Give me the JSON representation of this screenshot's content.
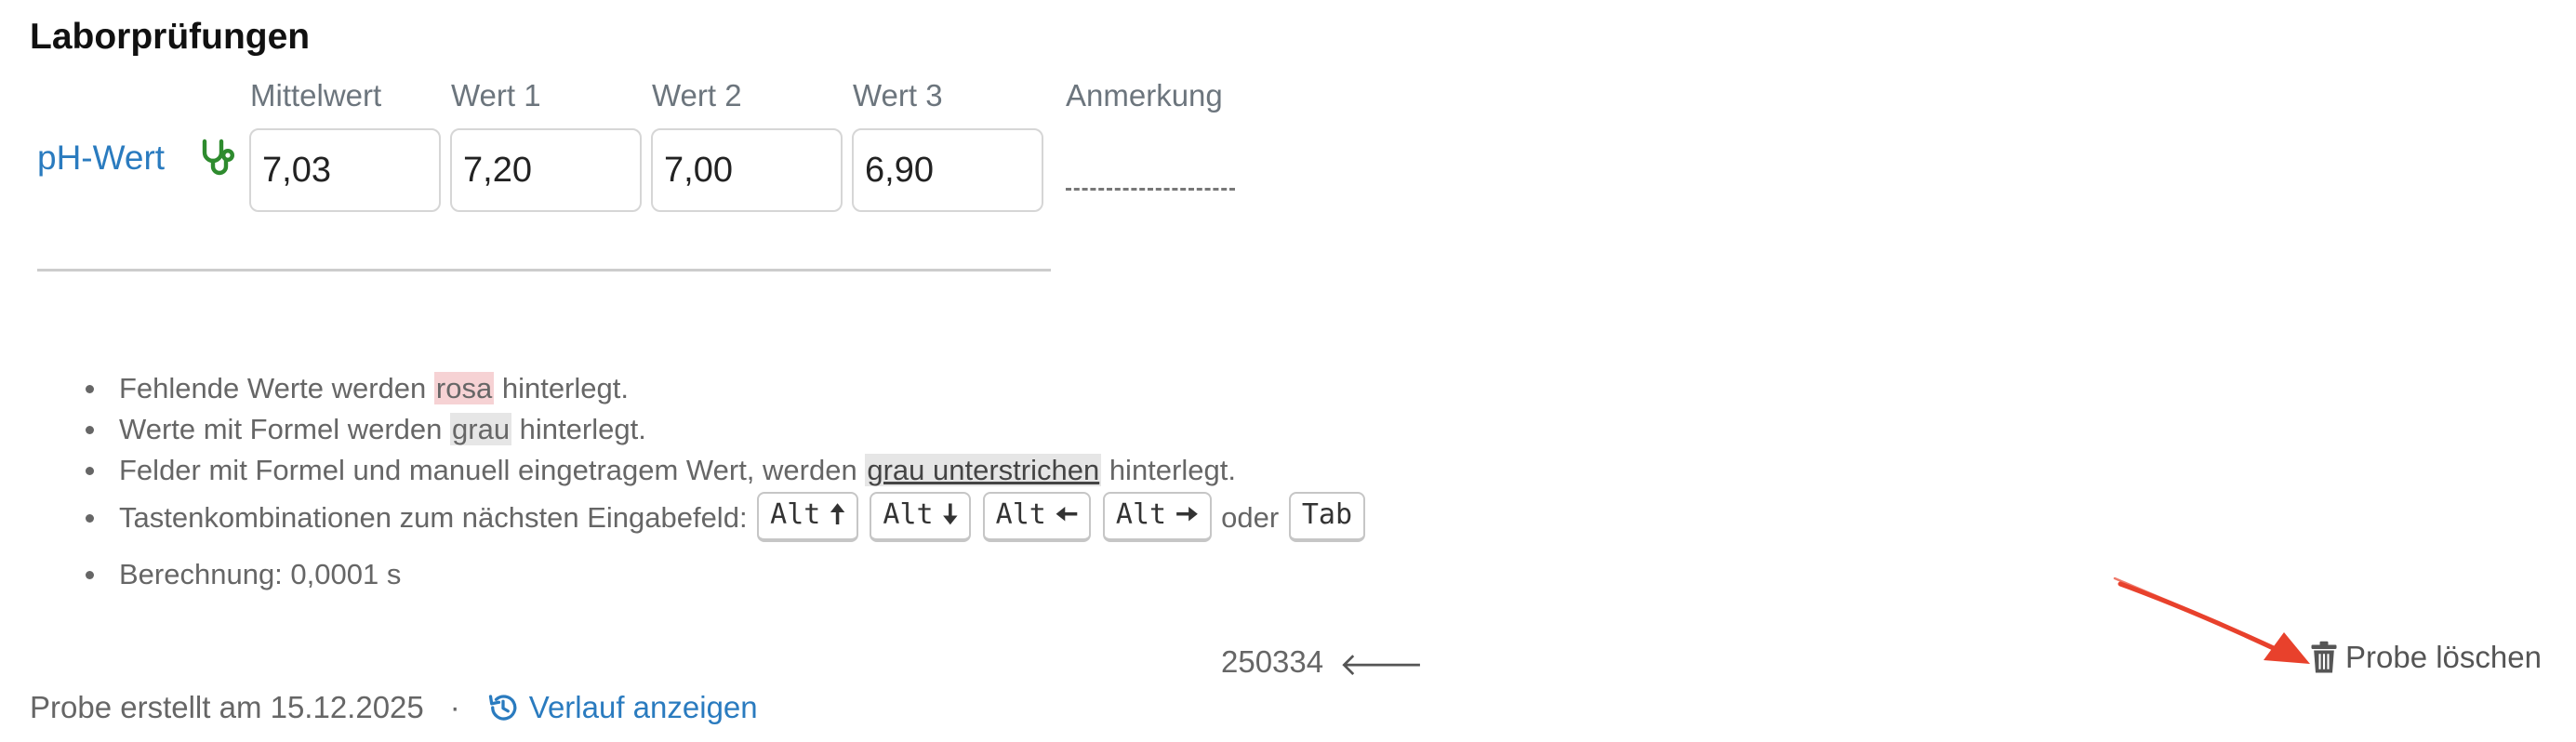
{
  "section": {
    "title": "Laborprüfungen"
  },
  "columns": [
    "Mittelwert",
    "Wert 1",
    "Wert 2",
    "Wert 3",
    "Anmerkung"
  ],
  "parameter": {
    "name": "pH-Wert",
    "icon": "stethoscope-icon",
    "values": {
      "mittelwert": "7,03",
      "wert1": "7,20",
      "wert2": "7,00",
      "wert3": "6,90"
    },
    "remark": ""
  },
  "legend": {
    "missing": {
      "prefix": "Fehlende Werte werden ",
      "highlight": "rosa",
      "suffix": " hinterlegt."
    },
    "formula": {
      "prefix": "Werte mit Formel werden ",
      "highlight": "grau",
      "suffix": " hinterlegt."
    },
    "formula_manual": {
      "prefix": "Felder mit Formel und manuell eingetragem Wert, werden ",
      "highlight": "grau unterstrichen",
      "suffix": " hinterlegt."
    },
    "shortcuts": {
      "prefix": "Tastenkombinationen zum nächsten Eingabefeld: ",
      "keys": [
        {
          "label": "Alt",
          "arrow": "🠅"
        },
        {
          "label": "Alt",
          "arrow": "🠇"
        },
        {
          "label": "Alt",
          "arrow": "🠄"
        },
        {
          "label": "Alt",
          "arrow": "🠆"
        }
      ],
      "or": "oder",
      "tab": "Tab"
    },
    "calculation": "Berechnung: 0,0001 s"
  },
  "sample": {
    "id": "250334",
    "back_icon": "arrow-left-icon"
  },
  "actions": {
    "delete_label": "Probe löschen",
    "delete_icon": "trash-icon"
  },
  "footer": {
    "created": "Probe erstellt am 15.12.2025",
    "separator": "·",
    "history_label": "Verlauf anzeigen",
    "history_icon": "history-icon"
  },
  "colors": {
    "link": "#2a7bbf",
    "stethoscope": "#2e8b2e",
    "highlight_pink": "#f6d2d4",
    "highlight_grey": "#e6e6e6",
    "annotation_arrow": "#e8412c"
  }
}
